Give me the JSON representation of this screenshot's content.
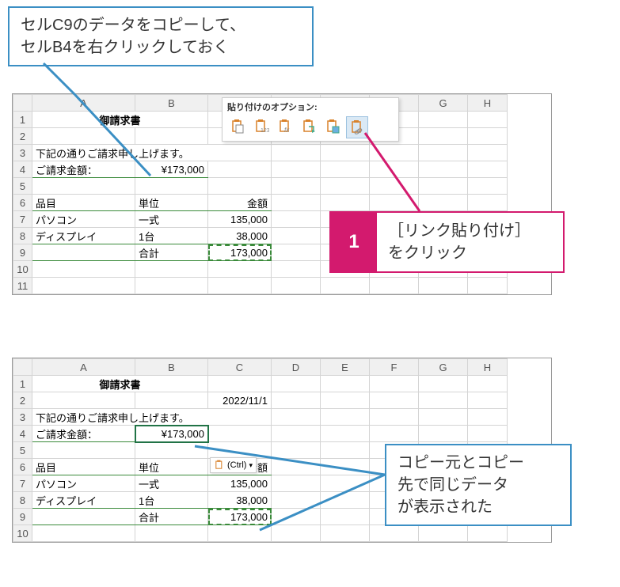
{
  "callout_top": {
    "line1": "セルC9のデータをコピーして、",
    "line2": "セルB4を右クリックしておく"
  },
  "callout_magenta": {
    "num": "1",
    "line1": "［リンク貼り付け］",
    "line2": "をクリック"
  },
  "callout_bottom": {
    "line1": "コピー元とコピー",
    "line2": "先で同じデータ",
    "line3": "が表示された"
  },
  "paste_options_label": "貼り付けのオプション:",
  "ctrl_label": "(Ctrl)",
  "sheet": {
    "cols": [
      "A",
      "B",
      "C",
      "D",
      "E",
      "F",
      "G",
      "H"
    ],
    "title": "御請求書",
    "date": "2022/11/1",
    "note": "下記の通りご請求申し上げます。",
    "request_label": "ご請求金額：",
    "request_amount": "¥173,000",
    "hdr_item": "品目",
    "hdr_unit": "単位",
    "hdr_amount": "金額",
    "row1_item": "パソコン",
    "row1_unit": "一式",
    "row1_amount": "135,000",
    "row2_item": "ディスプレイ",
    "row2_unit": "1台",
    "row2_amount": "38,000",
    "total_label": "合計",
    "total_amount": "173,000"
  },
  "icons": {
    "paste_all": "paste-all",
    "paste_values": "paste-values",
    "paste_formulas": "paste-formulas",
    "paste_transpose": "paste-transpose",
    "paste_formatting": "paste-formatting",
    "paste_link": "paste-link"
  }
}
